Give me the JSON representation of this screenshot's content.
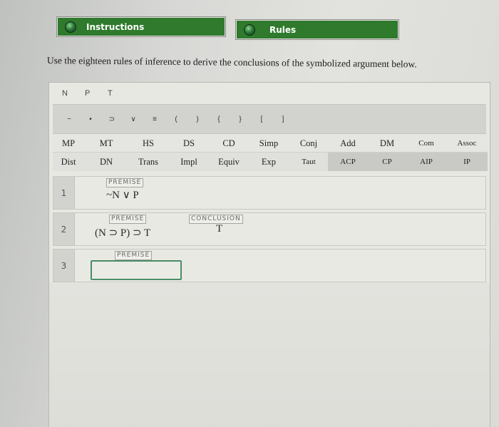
{
  "tabs": {
    "instructions": "Instructions",
    "rules": "Rules"
  },
  "instruction_text": "Use the eighteen rules of inference to derive the conclusions of the symbolized argument below.",
  "variables": [
    "N",
    "P",
    "T"
  ],
  "symbols": [
    "~",
    "•",
    "⊃",
    "∨",
    "≡",
    "(",
    ")",
    "{",
    "}",
    "[",
    "]"
  ],
  "rules_row1": [
    "MP",
    "MT",
    "HS",
    "DS",
    "CD",
    "Simp",
    "Conj",
    "Add",
    "DM",
    "Com",
    "Assoc"
  ],
  "rules_row2": [
    "Dist",
    "DN",
    "Trans",
    "Impl",
    "Equiv",
    "Exp",
    "Taut",
    "ACP",
    "CP",
    "AIP",
    "IP"
  ],
  "lines": [
    {
      "number": "1",
      "tag": "PREMISE",
      "formula": "~N ∨ P"
    },
    {
      "number": "2",
      "tag": "PREMISE",
      "formula": "(N ⊃ P) ⊃ T",
      "conclusion_tag": "CONCLUSION",
      "conclusion": "T"
    },
    {
      "number": "3",
      "tag": "PREMISE",
      "formula": ""
    }
  ],
  "colors": {
    "tab_green": "#2f7a2c",
    "input_border": "#4a8d68"
  }
}
